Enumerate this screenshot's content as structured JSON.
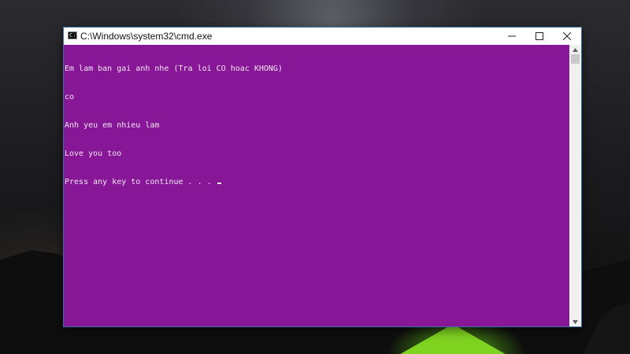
{
  "window": {
    "title": "C:\\Windows\\system32\\cmd.exe",
    "icon_label": "C:\\",
    "controls": {
      "minimize_icon": "minimize-icon",
      "maximize_icon": "maximize-icon",
      "close_icon": "close-icon"
    }
  },
  "console": {
    "background_color": "#881798",
    "text_color": "#f0e6f2",
    "lines": [
      "Em lam ban gai anh nhe (Tra loi CO hoac KHONG)",
      "co",
      "Anh yeu em nhieu lam",
      "Love you too",
      "Press any key to continue . . . "
    ]
  }
}
